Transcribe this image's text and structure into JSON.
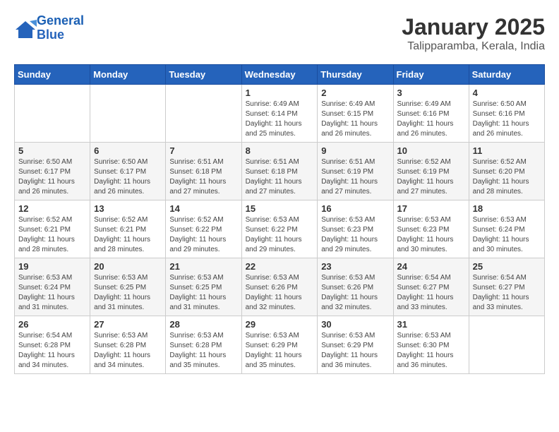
{
  "header": {
    "logo_line1": "General",
    "logo_line2": "Blue",
    "month": "January 2025",
    "location": "Talipparamba, Kerala, India"
  },
  "weekdays": [
    "Sunday",
    "Monday",
    "Tuesday",
    "Wednesday",
    "Thursday",
    "Friday",
    "Saturday"
  ],
  "weeks": [
    [
      {
        "day": "",
        "info": ""
      },
      {
        "day": "",
        "info": ""
      },
      {
        "day": "",
        "info": ""
      },
      {
        "day": "1",
        "info": "Sunrise: 6:49 AM\nSunset: 6:14 PM\nDaylight: 11 hours and 25 minutes."
      },
      {
        "day": "2",
        "info": "Sunrise: 6:49 AM\nSunset: 6:15 PM\nDaylight: 11 hours and 26 minutes."
      },
      {
        "day": "3",
        "info": "Sunrise: 6:49 AM\nSunset: 6:16 PM\nDaylight: 11 hours and 26 minutes."
      },
      {
        "day": "4",
        "info": "Sunrise: 6:50 AM\nSunset: 6:16 PM\nDaylight: 11 hours and 26 minutes."
      }
    ],
    [
      {
        "day": "5",
        "info": "Sunrise: 6:50 AM\nSunset: 6:17 PM\nDaylight: 11 hours and 26 minutes."
      },
      {
        "day": "6",
        "info": "Sunrise: 6:50 AM\nSunset: 6:17 PM\nDaylight: 11 hours and 26 minutes."
      },
      {
        "day": "7",
        "info": "Sunrise: 6:51 AM\nSunset: 6:18 PM\nDaylight: 11 hours and 27 minutes."
      },
      {
        "day": "8",
        "info": "Sunrise: 6:51 AM\nSunset: 6:18 PM\nDaylight: 11 hours and 27 minutes."
      },
      {
        "day": "9",
        "info": "Sunrise: 6:51 AM\nSunset: 6:19 PM\nDaylight: 11 hours and 27 minutes."
      },
      {
        "day": "10",
        "info": "Sunrise: 6:52 AM\nSunset: 6:19 PM\nDaylight: 11 hours and 27 minutes."
      },
      {
        "day": "11",
        "info": "Sunrise: 6:52 AM\nSunset: 6:20 PM\nDaylight: 11 hours and 28 minutes."
      }
    ],
    [
      {
        "day": "12",
        "info": "Sunrise: 6:52 AM\nSunset: 6:21 PM\nDaylight: 11 hours and 28 minutes."
      },
      {
        "day": "13",
        "info": "Sunrise: 6:52 AM\nSunset: 6:21 PM\nDaylight: 11 hours and 28 minutes."
      },
      {
        "day": "14",
        "info": "Sunrise: 6:52 AM\nSunset: 6:22 PM\nDaylight: 11 hours and 29 minutes."
      },
      {
        "day": "15",
        "info": "Sunrise: 6:53 AM\nSunset: 6:22 PM\nDaylight: 11 hours and 29 minutes."
      },
      {
        "day": "16",
        "info": "Sunrise: 6:53 AM\nSunset: 6:23 PM\nDaylight: 11 hours and 29 minutes."
      },
      {
        "day": "17",
        "info": "Sunrise: 6:53 AM\nSunset: 6:23 PM\nDaylight: 11 hours and 30 minutes."
      },
      {
        "day": "18",
        "info": "Sunrise: 6:53 AM\nSunset: 6:24 PM\nDaylight: 11 hours and 30 minutes."
      }
    ],
    [
      {
        "day": "19",
        "info": "Sunrise: 6:53 AM\nSunset: 6:24 PM\nDaylight: 11 hours and 31 minutes."
      },
      {
        "day": "20",
        "info": "Sunrise: 6:53 AM\nSunset: 6:25 PM\nDaylight: 11 hours and 31 minutes."
      },
      {
        "day": "21",
        "info": "Sunrise: 6:53 AM\nSunset: 6:25 PM\nDaylight: 11 hours and 31 minutes."
      },
      {
        "day": "22",
        "info": "Sunrise: 6:53 AM\nSunset: 6:26 PM\nDaylight: 11 hours and 32 minutes."
      },
      {
        "day": "23",
        "info": "Sunrise: 6:53 AM\nSunset: 6:26 PM\nDaylight: 11 hours and 32 minutes."
      },
      {
        "day": "24",
        "info": "Sunrise: 6:54 AM\nSunset: 6:27 PM\nDaylight: 11 hours and 33 minutes."
      },
      {
        "day": "25",
        "info": "Sunrise: 6:54 AM\nSunset: 6:27 PM\nDaylight: 11 hours and 33 minutes."
      }
    ],
    [
      {
        "day": "26",
        "info": "Sunrise: 6:54 AM\nSunset: 6:28 PM\nDaylight: 11 hours and 34 minutes."
      },
      {
        "day": "27",
        "info": "Sunrise: 6:53 AM\nSunset: 6:28 PM\nDaylight: 11 hours and 34 minutes."
      },
      {
        "day": "28",
        "info": "Sunrise: 6:53 AM\nSunset: 6:28 PM\nDaylight: 11 hours and 35 minutes."
      },
      {
        "day": "29",
        "info": "Sunrise: 6:53 AM\nSunset: 6:29 PM\nDaylight: 11 hours and 35 minutes."
      },
      {
        "day": "30",
        "info": "Sunrise: 6:53 AM\nSunset: 6:29 PM\nDaylight: 11 hours and 36 minutes."
      },
      {
        "day": "31",
        "info": "Sunrise: 6:53 AM\nSunset: 6:30 PM\nDaylight: 11 hours and 36 minutes."
      },
      {
        "day": "",
        "info": ""
      }
    ]
  ]
}
